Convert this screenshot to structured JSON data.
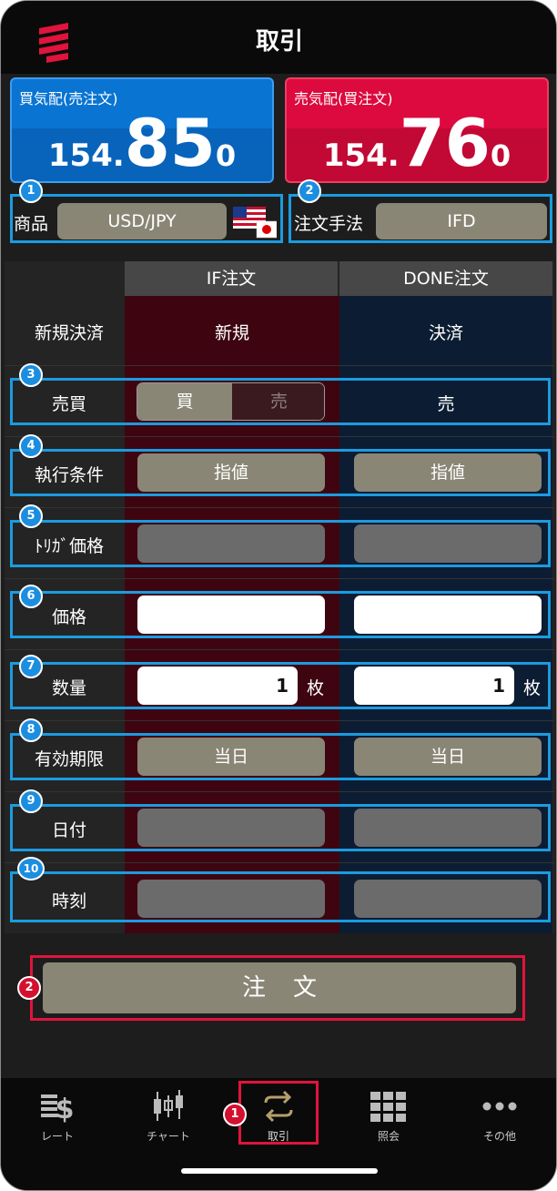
{
  "header": {
    "title": "取引"
  },
  "bid": {
    "label": "買気配(売注文)",
    "prefix": "154.",
    "big": "85",
    "suffix": "0"
  },
  "ask": {
    "label": "売気配(買注文)",
    "prefix": "154.",
    "big": "76",
    "suffix": "0"
  },
  "product": {
    "label": "商品",
    "value": "USD/JPY"
  },
  "method": {
    "label": "注文手法",
    "value": "IFD"
  },
  "table": {
    "col_if": "IF注文",
    "col_done": "DONE注文",
    "rows": {
      "new_settle": {
        "label": "新規決済",
        "if": "新規",
        "done": "決済"
      },
      "buy_sell": {
        "label": "売買",
        "if_buy": "買",
        "if_sell": "売",
        "done": "売"
      },
      "exec": {
        "label": "執行条件",
        "if": "指値",
        "done": "指値"
      },
      "trigger": {
        "label": "ﾄﾘｶﾞ価格"
      },
      "price": {
        "label": "価格"
      },
      "qty": {
        "label": "数量",
        "if": "1",
        "done": "1",
        "unit": "枚"
      },
      "expiry": {
        "label": "有効期限",
        "if": "当日",
        "done": "当日"
      },
      "date": {
        "label": "日付"
      },
      "time": {
        "label": "時刻"
      }
    }
  },
  "order_button": {
    "label": "注文"
  },
  "badges": [
    "1",
    "2",
    "3",
    "4",
    "5",
    "6",
    "7",
    "8",
    "9",
    "10"
  ],
  "red_badges": [
    "2",
    "1"
  ],
  "tabs": [
    {
      "label": "レート",
      "icon": "rate-icon"
    },
    {
      "label": "チャート",
      "icon": "candlestick-icon"
    },
    {
      "label": "取引",
      "icon": "trade-arrows-icon"
    },
    {
      "label": "照会",
      "icon": "grid-icon"
    },
    {
      "label": "その他",
      "icon": "more-dots-icon"
    }
  ],
  "colors": {
    "accent_blue": "#1c9be0",
    "accent_red": "#e0143c",
    "buy_blue": "#0a74d2",
    "sell_red": "#dc0a3e",
    "tan": "#8a8676"
  }
}
